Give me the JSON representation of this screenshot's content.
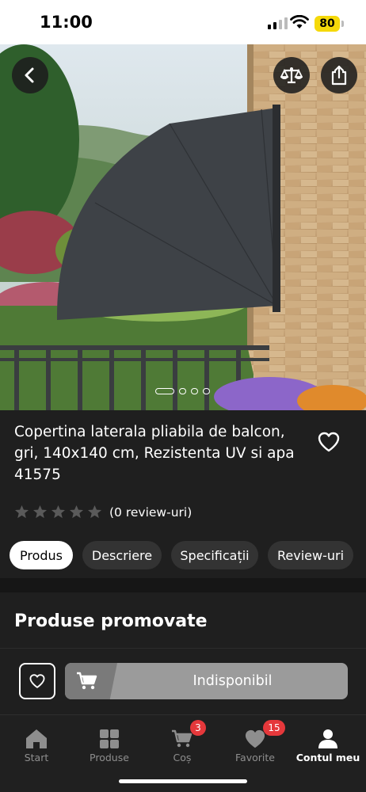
{
  "status_bar": {
    "time": "11:00",
    "battery": "80"
  },
  "product": {
    "title": "Copertina laterala pliabila de balcon, gri, 140x140 cm, Rezistenta UV si apa 41575",
    "rating_value": 0,
    "rating_max": 5,
    "reviews_label": "(0 review-uri)",
    "gallery": {
      "count": 4,
      "active": 1
    }
  },
  "tabs": [
    {
      "label": "Produs",
      "active": true
    },
    {
      "label": "Descriere",
      "active": false
    },
    {
      "label": "Specificații",
      "active": false
    },
    {
      "label": "Review-uri",
      "active": false
    }
  ],
  "promoted": {
    "heading": "Produse promovate",
    "cart_button_label": "Indisponibil"
  },
  "bottom_nav": [
    {
      "label": "Start",
      "icon": "home-icon",
      "active": false
    },
    {
      "label": "Produse",
      "icon": "grid-icon",
      "active": false
    },
    {
      "label": "Coș",
      "icon": "cart-icon",
      "badge": "3",
      "active": false
    },
    {
      "label": "Favorite",
      "icon": "heart-icon",
      "badge": "15",
      "active": false
    },
    {
      "label": "Contul meu",
      "icon": "user-icon",
      "active": true
    }
  ],
  "colors": {
    "background": "#1f1f1f",
    "badge": "#e5383b",
    "battery": "#f5d90a",
    "tab_active_bg": "#ffffff",
    "button_disabled": "#9b9b9b"
  }
}
